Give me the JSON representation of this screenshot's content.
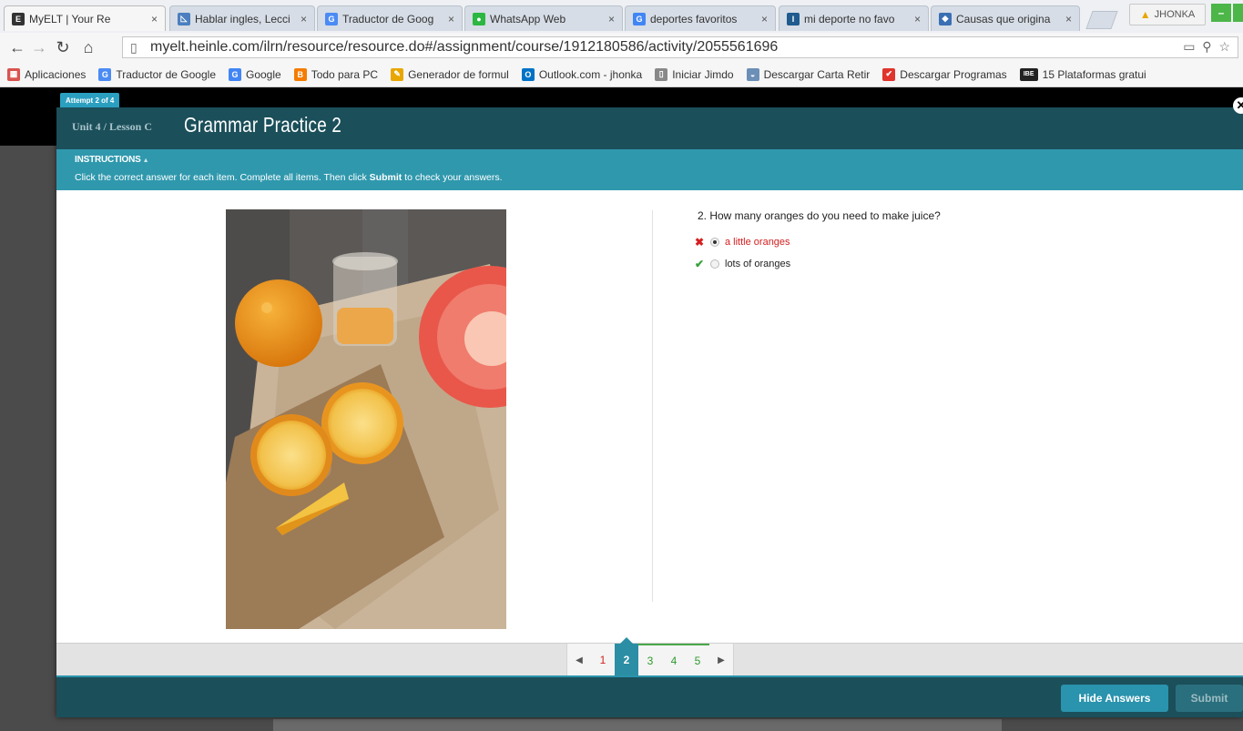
{
  "browser": {
    "tabs": [
      {
        "title": "MyELT | Your Re",
        "icon": "E",
        "icon_color": "#333333",
        "active": true
      },
      {
        "title": "Hablar ingles, Lecci",
        "icon": "◺",
        "icon_color": "#4b7fbf"
      },
      {
        "title": "Traductor de Goog",
        "icon": "G",
        "icon_color": "#4b8bf4"
      },
      {
        "title": "WhatsApp Web",
        "icon": "●",
        "icon_color": "#2bb741"
      },
      {
        "title": "deportes favoritos",
        "icon": "G",
        "icon_color": "#4285f4"
      },
      {
        "title": "mi deporte no favo",
        "icon": "I",
        "icon_color": "#1f5b8e"
      },
      {
        "title": "Causas que origina",
        "icon": "◆",
        "icon_color": "#3b6fb3"
      }
    ],
    "user": "JHONKA",
    "url": "myelt.heinle.com/ilrn/resource/resource.do#/assignment/course/1912180586/activity/2055561696",
    "bookmarks": [
      {
        "label": "Aplicaciones",
        "icon": "▦",
        "color": "#d9534f"
      },
      {
        "label": "Traductor de Google",
        "icon": "G",
        "color": "#4b8bf4"
      },
      {
        "label": "Google",
        "icon": "G",
        "color": "#4285f4"
      },
      {
        "label": "Todo para PC",
        "icon": "B",
        "color": "#f57c00"
      },
      {
        "label": "Generador de formul",
        "icon": "✎",
        "color": "#e8a600"
      },
      {
        "label": "Outlook.com - jhonka",
        "icon": "O",
        "color": "#0072c6"
      },
      {
        "label": "Iniciar Jimdo",
        "icon": "▯",
        "color": "#888888"
      },
      {
        "label": "Descargar Carta Retir",
        "icon": "◒",
        "color": "#6c8fb8"
      },
      {
        "label": "Descargar Programas",
        "icon": "✔",
        "color": "#e0342c"
      },
      {
        "label": "15 Plataformas gratui",
        "icon": "IBE",
        "color": "#222222"
      }
    ]
  },
  "activity": {
    "attempt": "Attempt 2 of 4",
    "unit": "Unit 4 / Lesson C",
    "title": "Grammar Practice 2",
    "instructions_label": "INSTRUCTIONS",
    "instructions_pre": "Click the correct answer for each item. Complete all items. Then click ",
    "instructions_bold": "Submit",
    "instructions_post": " to check your answers.",
    "question": "2. How many oranges do you need to make juice?",
    "options": [
      {
        "label": "a little oranges",
        "selected": true,
        "mark": "✖",
        "mark_color": "#d32020",
        "text_color": "#d32020"
      },
      {
        "label": "lots of oranges",
        "selected": false,
        "mark": "✔",
        "mark_color": "#3aa03a",
        "text_color": "#222222"
      }
    ],
    "pages": [
      {
        "n": "1",
        "state": "red"
      },
      {
        "n": "2",
        "state": "current"
      },
      {
        "n": "3",
        "state": "green"
      },
      {
        "n": "4",
        "state": "green"
      },
      {
        "n": "5",
        "state": "green"
      }
    ],
    "hide_answers": "Hide Answers",
    "submit": "Submit"
  }
}
